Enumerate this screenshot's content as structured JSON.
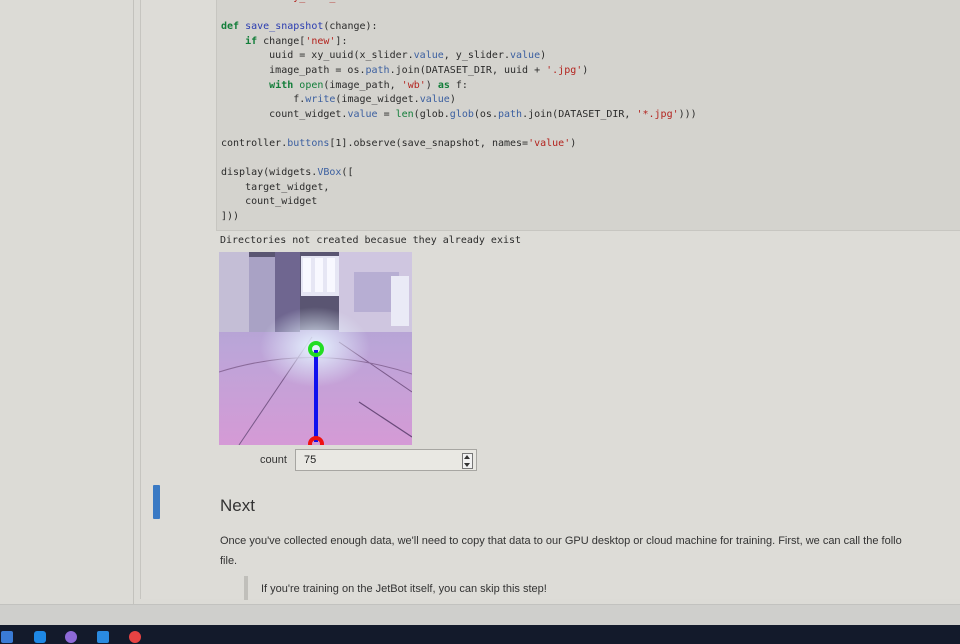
{
  "code_lines": [
    "    return xy_uuid_....",
    "",
    "def save_snapshot(change):",
    "    if change['new']:",
    "        uuid = xy_uuid(x_slider.value, y_slider.value)",
    "        image_path = os.path.join(DATASET_DIR, uuid + '.jpg')",
    "        with open(image_path, 'wb') as f:",
    "            f.write(image_widget.value)",
    "        count_widget.value = len(glob.glob(os.path.join(DATASET_DIR, '*.jpg')))",
    "",
    "controller.buttons[1].observe(save_snapshot, names='value')",
    "",
    "display(widgets.VBox([",
    "    target_widget,",
    "    count_widget",
    "]))"
  ],
  "output": {
    "message": "Directories not created becasue they already exist"
  },
  "count_widget": {
    "label": "count",
    "value": "75"
  },
  "markdown": {
    "heading": "Next",
    "paragraph_line1": "Once you've collected enough data, we'll need to copy that data to our GPU desktop or cloud machine for training. First, we can call the follo",
    "paragraph_line2": "file.",
    "blockquote": "If you're training on the JetBot itself, you can skip this step!"
  },
  "colors": {
    "accent_bar": "#3a7ac4",
    "target_green": "#22dd22",
    "target_line_blue": "#1010ee",
    "origin_red": "#ee1111"
  },
  "taskbar_icons": [
    "wps-icon",
    "phone-icon",
    "discord-icon",
    "vscode-icon",
    "app-red-icon"
  ]
}
